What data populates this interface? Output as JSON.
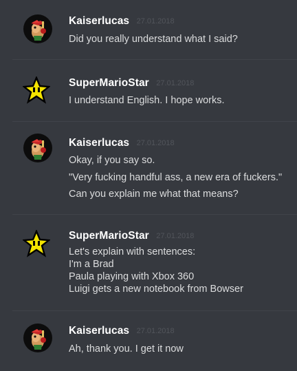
{
  "colors": {
    "background": "#36393f",
    "username": "#ffffff",
    "timestamp": "#52555b",
    "message_text": "#dcddde",
    "divider": "#40434a"
  },
  "messages": [
    {
      "username": "Kaiserlucas",
      "timestamp": "27.01.2018",
      "avatar": "kaiserlucas-avatar",
      "lines": [
        "Did you really understand what I said?"
      ]
    },
    {
      "username": "SuperMarioStar",
      "timestamp": "27.01.2018",
      "avatar": "super-star-icon",
      "lines": [
        "I understand English. I hope works."
      ]
    },
    {
      "username": "Kaiserlucas",
      "timestamp": "27.01.2018",
      "avatar": "kaiserlucas-avatar",
      "lines": [
        "Okay, if you say so.",
        "\"Very fucking handful ass, a new era of fuckers.\"",
        "Can you explain me what that means?"
      ]
    },
    {
      "username": "SuperMarioStar",
      "timestamp": "27.01.2018",
      "avatar": "super-star-icon",
      "lines": [
        "Let's explain with sentences:",
        "I'm a Brad",
        "Paula playing with Xbox 360",
        "Luigi gets a new notebook from Bowser"
      ]
    },
    {
      "username": "Kaiserlucas",
      "timestamp": "27.01.2018",
      "avatar": "kaiserlucas-avatar",
      "lines": [
        "Ah, thank you. I get it now"
      ]
    }
  ]
}
